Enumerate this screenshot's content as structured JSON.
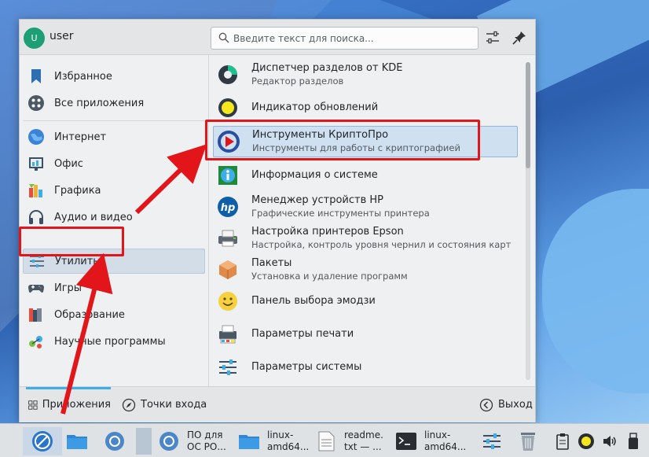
{
  "header": {
    "avatar_letter": "U",
    "username": "user",
    "search_placeholder": "Введите текст для поиска..."
  },
  "sidebar": {
    "items": [
      {
        "label": "Избранное",
        "icon": "bookmark-icon"
      },
      {
        "label": "Все приложения",
        "icon": "grid-icon"
      },
      {
        "label": "Интернет",
        "icon": "globe-icon"
      },
      {
        "label": "Офис",
        "icon": "office-icon"
      },
      {
        "label": "Графика",
        "icon": "graphics-icon"
      },
      {
        "label": "Аудио и видео",
        "icon": "headphones-icon"
      },
      {
        "label": "Утилиты",
        "icon": "utilities-icon",
        "selected": true
      },
      {
        "label": "Игры",
        "icon": "gamepad-icon"
      },
      {
        "label": "Образование",
        "icon": "education-icon"
      },
      {
        "label": "Научные программы",
        "icon": "science-icon"
      }
    ]
  },
  "apps": {
    "items": [
      {
        "name": "Диспетчер разделов от KDE",
        "desc": "Редактор разделов",
        "icon": "partition-manager-icon"
      },
      {
        "name": "Индикатор обновлений",
        "desc": "",
        "icon": "update-indicator-icon"
      },
      {
        "name": "Инструменты КриптоПро",
        "desc": "Инструменты для работы с криптографией",
        "icon": "cryptopro-icon",
        "selected": true
      },
      {
        "name": "Информация о системе",
        "desc": "",
        "icon": "system-info-icon"
      },
      {
        "name": "Менеджер устройств HP",
        "desc": "Графические инструменты принтера",
        "icon": "hp-icon"
      },
      {
        "name": "Настройка принтеров Epson",
        "desc": "Настройка, контроль уровня чернил и состояния картриджей",
        "icon": "printer-icon"
      },
      {
        "name": "Пакеты",
        "desc": "Установка и удаление программ",
        "icon": "package-icon"
      },
      {
        "name": "Панель выбора эмодзи",
        "desc": "",
        "icon": "emoji-icon"
      },
      {
        "name": "Параметры печати",
        "desc": "",
        "icon": "print-settings-icon"
      },
      {
        "name": "Параметры системы",
        "desc": "",
        "icon": "system-settings-icon"
      }
    ]
  },
  "footer": {
    "applications_label": "Приложения",
    "places_label": "Точки входа",
    "logout_label": "Выход"
  },
  "taskbar": {
    "items": [
      {
        "label": "",
        "icon": "launcher-icon"
      },
      {
        "label": "",
        "icon": "folder-icon"
      },
      {
        "label": "",
        "icon": "chromium-icon"
      },
      {
        "label": "",
        "icon": "window-thumbnail-icon"
      },
      {
        "label": "ПО для\nОС РО...",
        "icon": "chromium-icon"
      },
      {
        "label": "linux-\namd64...",
        "icon": "folder-icon"
      },
      {
        "label": "readme.\ntxt — ...",
        "icon": "text-file-icon"
      },
      {
        "label": "linux-\namd64...",
        "icon": "terminal-icon"
      }
    ],
    "tray": [
      "mixer-icon",
      "trash-icon",
      "clipboard-icon",
      "update-icon",
      "volume-icon",
      "usb-icon"
    ]
  },
  "colors": {
    "accent": "#3daee9",
    "annotation": "#e2151b",
    "selection": "#cfe0f1"
  }
}
